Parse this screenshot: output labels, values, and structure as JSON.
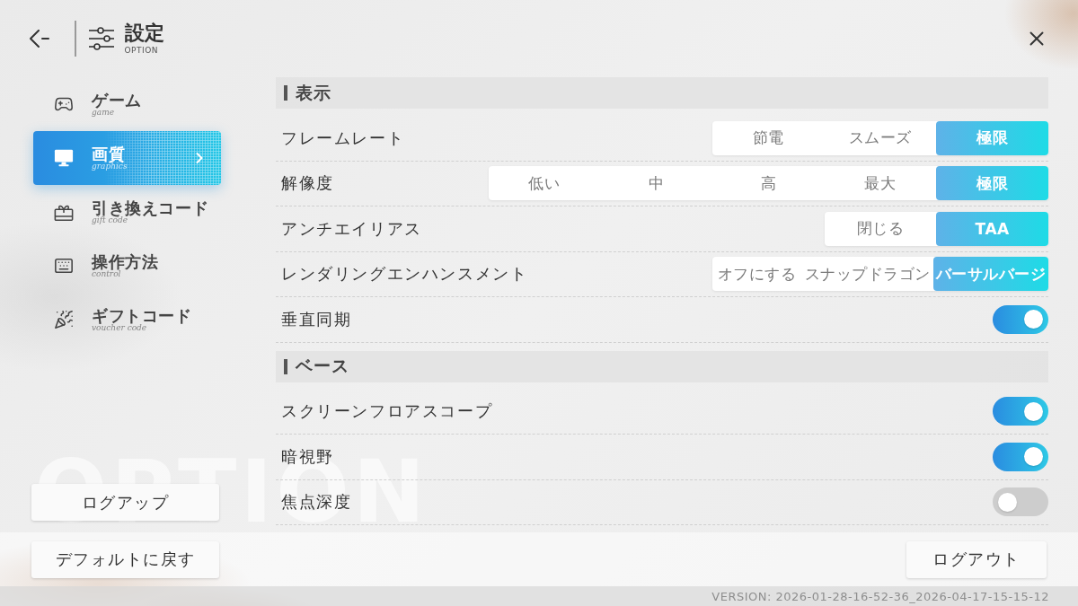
{
  "header": {
    "title": "設定",
    "subtitle": "OPTION"
  },
  "sidebar": {
    "items": [
      {
        "label": "ゲーム",
        "sublabel": "game",
        "selected": false
      },
      {
        "label": "画質",
        "sublabel": "graphics",
        "selected": true
      },
      {
        "label": "引き換えコード",
        "sublabel": "gift code",
        "selected": false
      },
      {
        "label": "操作方法",
        "sublabel": "control",
        "selected": false
      },
      {
        "label": "ギフトコード",
        "sublabel": "voucher code",
        "selected": false
      }
    ]
  },
  "background_text": "OPTION",
  "sections": [
    {
      "title": "表示",
      "rows": [
        {
          "kind": "segments",
          "label": "フレームレート",
          "options": [
            {
              "label": "節電",
              "selected": false
            },
            {
              "label": "スムーズ",
              "selected": false
            },
            {
              "label": "極限",
              "selected": true
            }
          ]
        },
        {
          "kind": "segments",
          "label": "解像度",
          "options": [
            {
              "label": "低い",
              "selected": false
            },
            {
              "label": "中",
              "selected": false
            },
            {
              "label": "高",
              "selected": false
            },
            {
              "label": "最大",
              "selected": false
            },
            {
              "label": "極限",
              "selected": true
            }
          ]
        },
        {
          "kind": "segments",
          "label": "アンチエイリアス",
          "options": [
            {
              "label": "閉じる",
              "selected": false
            },
            {
              "label": "TAA",
              "selected": true
            }
          ]
        },
        {
          "kind": "segments",
          "label": "レンダリングエンハンスメント",
          "options": [
            {
              "label": "オフにする",
              "selected": false
            },
            {
              "label": "スナップドラゴン",
              "selected": false
            },
            {
              "label": "バーサルバージ",
              "selected": true
            }
          ]
        },
        {
          "kind": "toggle",
          "label": "垂直同期",
          "on": true
        }
      ]
    },
    {
      "title": "ベース",
      "rows": [
        {
          "kind": "toggle",
          "label": "スクリーンフロアスコープ",
          "on": true
        },
        {
          "kind": "toggle",
          "label": "暗視野",
          "on": true
        },
        {
          "kind": "toggle",
          "label": "焦点深度",
          "on": false
        }
      ]
    }
  ],
  "upload_button": "ログアップ",
  "reset_button": "デフォルトに戻す",
  "logout_button": "ログアウト",
  "version": "VERSION: 2026-01-28-16-52-36_2026-04-17-15-15-12"
}
